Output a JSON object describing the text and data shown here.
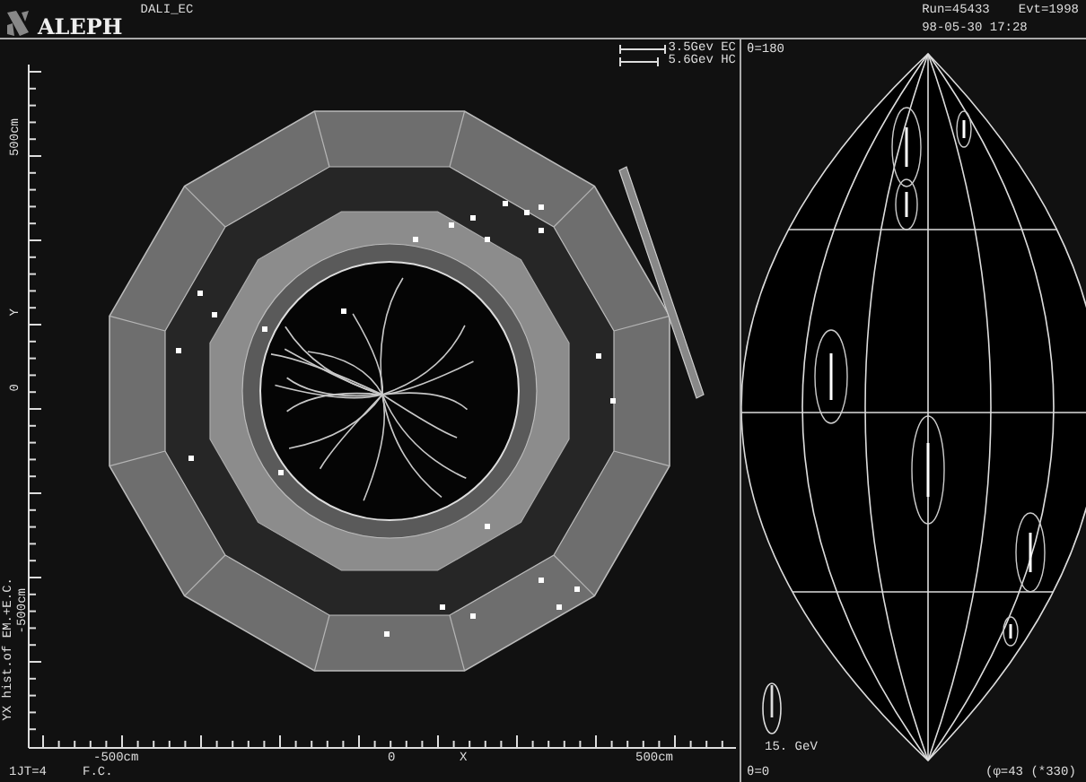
{
  "header": {
    "logo_text": "ALEPH",
    "program": "DALI_EC",
    "datetime": "98-05-30 17:28",
    "run": "Run=45433",
    "event": "Evt=1998"
  },
  "yx_view": {
    "legend": [
      {
        "label": "3.5Gev EC"
      },
      {
        "label": "5.6Gev HC"
      }
    ],
    "y_labels": [
      "500cm",
      "Y",
      "0",
      "-500cm"
    ],
    "title": "YX hist.of EM.+E.C.",
    "x_labels": [
      "-500cm",
      "0",
      "X",
      "500cm"
    ],
    "footer": [
      "1JT=4",
      "F.C."
    ]
  },
  "angle_view": {
    "top_label": "θ=180",
    "bottom_label": "θ=0",
    "scale": "15. GeV",
    "phi": "(φ=43 (*330)"
  }
}
